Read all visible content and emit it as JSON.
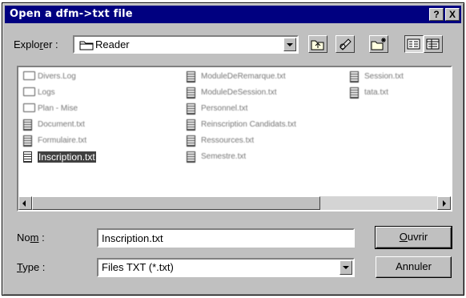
{
  "window": {
    "title": "Open a dfm->txt file",
    "help_label": "?",
    "close_label": "X"
  },
  "explorer": {
    "label_pre": "Explo",
    "label_u": "r",
    "label_post": "er :",
    "current_folder": "Reader"
  },
  "toolbar": {
    "icons": [
      "up-folder-icon",
      "desktop-icon",
      "new-folder-icon",
      "list-view-icon",
      "details-view-icon"
    ]
  },
  "files": [
    {
      "name": "Divers.Log",
      "type": "folder"
    },
    {
      "name": "Logs",
      "type": "folder"
    },
    {
      "name": "Plan - Mise",
      "type": "folder"
    },
    {
      "name": "Document.txt",
      "type": "doc"
    },
    {
      "name": "Formulaire.txt",
      "type": "doc"
    },
    {
      "name": "Inscription.txt",
      "type": "doc",
      "selected": true
    },
    {
      "name": "ModuleDeRemarque.txt",
      "type": "doc"
    },
    {
      "name": "ModuleDeSession.txt",
      "type": "doc"
    },
    {
      "name": "Personnel.txt",
      "type": "doc"
    },
    {
      "name": "Reinscription Candidats.txt",
      "type": "doc"
    },
    {
      "name": "Ressources.txt",
      "type": "doc"
    },
    {
      "name": "Semestre.txt",
      "type": "doc"
    },
    {
      "name": "Session.txt",
      "type": "doc"
    },
    {
      "name": "tata.txt",
      "type": "doc"
    }
  ],
  "name_field": {
    "label_pre": "No",
    "label_u": "m",
    "label_post": " :",
    "value": "Inscription.txt"
  },
  "type_field": {
    "label_u": "T",
    "label_post": "ype :",
    "value": "Files TXT (*.txt)"
  },
  "buttons": {
    "open_u": "O",
    "open_rest": "uvrir",
    "cancel": "Annuler"
  }
}
